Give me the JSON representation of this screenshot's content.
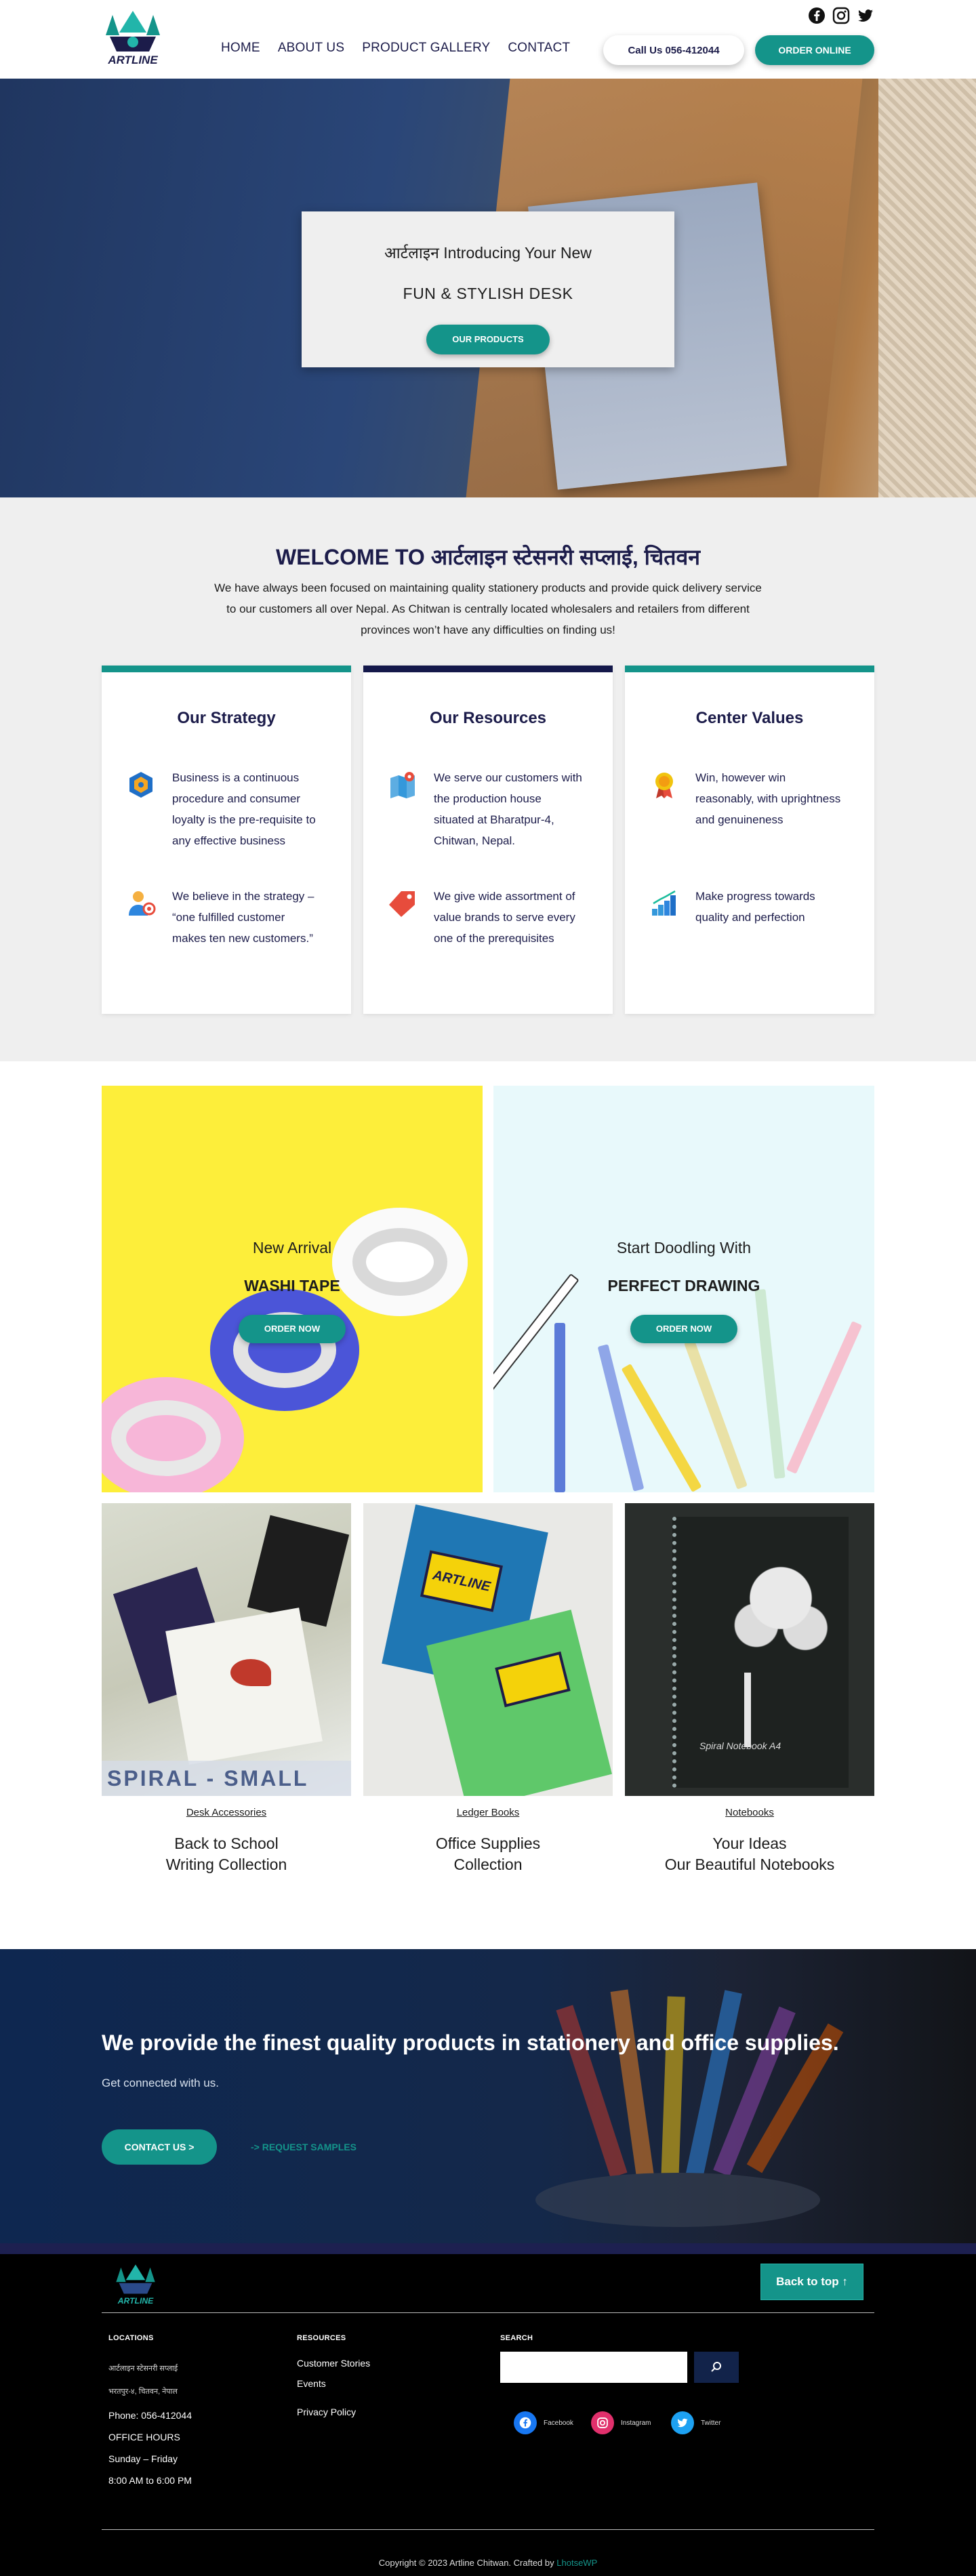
{
  "brand": {
    "logo_text": "ARTLINE",
    "logo_colors": {
      "teal": "#14948a",
      "navy": "#1c1c4a"
    }
  },
  "header": {
    "nav": [
      "HOME",
      "ABOUT US",
      "PRODUCT GALLERY",
      "CONTACT"
    ],
    "call_label": "Call Us 056-412044",
    "order_label": "ORDER ONLINE",
    "social_icons": [
      "facebook-icon",
      "instagram-icon",
      "twitter-icon"
    ]
  },
  "hero": {
    "line1": "आर्टलाइन Introducing Your New",
    "line2": "FUN & STYLISH DESK",
    "button": "OUR PRODUCTS"
  },
  "welcome": {
    "title": "WELCOME TO आर्टलाइन स्टेसनरी सप्लाई, चितवन",
    "text": "We have always been focused on maintaining quality stationery products and provide quick delivery service to our customers all over Nepal. As Chitwan is centrally located wholesalers and retailers from different provinces won’t have any difficulties on finding us!",
    "cards": [
      {
        "title": "Our Strategy",
        "bar_color": "#14948a",
        "items": [
          {
            "icon": "strategy-hexagon-icon",
            "text": "Business is a continuous procedure and consumer loyalty is the pre-requisite to any effective business"
          },
          {
            "icon": "person-target-icon",
            "text": "We believe in the strategy – “one fulfilled customer makes ten new customers.”"
          }
        ]
      },
      {
        "title": "Our Resources",
        "bar_color": "#14184a",
        "items": [
          {
            "icon": "map-pin-icon",
            "text": "We serve our customers with the production house situated at Bharatpur-4, Chitwan, Nepal."
          },
          {
            "icon": "price-tag-icon",
            "text": "We give wide assortment of value brands to serve every one of the prerequisites"
          }
        ]
      },
      {
        "title": "Center Values",
        "bar_color": "#14948a",
        "items": [
          {
            "icon": "award-medal-icon",
            "text": "Win, however win reasonably, with uprightness and genuineness"
          },
          {
            "icon": "growth-stairs-icon",
            "text": "Make progress towards quality and perfection"
          }
        ]
      }
    ]
  },
  "promo": {
    "left": {
      "line1": "New Arrival",
      "line2": "WASHI TAPE",
      "button": "ORDER NOW"
    },
    "right": {
      "line1": "Start Doodling With",
      "line2": "PERFECT DRAWING",
      "button": "ORDER NOW"
    },
    "tiles": [
      {
        "link": "Desk Accessories",
        "caption1": "Back to School",
        "caption2": "Writing Collection",
        "overlay": "SPIRAL - SMALL"
      },
      {
        "link": "Ledger Books",
        "caption1": "Office Supplies",
        "caption2": "Collection",
        "overlay": "ARTLINE"
      },
      {
        "link": "Notebooks",
        "caption1": "Your Ideas",
        "caption2": "Our Beautiful Notebooks",
        "overlay": "Spiral Notebook A4"
      }
    ]
  },
  "cta": {
    "title": "We provide the finest quality products in stationery and office supplies.",
    "subtitle": "Get connected with us.",
    "button": "CONTACT US >",
    "link": "-> REQUEST SAMPLES"
  },
  "footer": {
    "back_to_top": "Back to top ↑",
    "locations": {
      "heading": "LOCATIONS",
      "line1": "आर्टलाइन स्टेसनरी सप्लाई",
      "line2": "भरतपुर-४, चितवन, नेपाल",
      "phone": "Phone: 056-412044",
      "hours_label": "OFFICE HOURS",
      "days": "Sunday – Friday",
      "time": "8:00 AM to 6:00 PM"
    },
    "resources": {
      "heading": "RESOURCES",
      "items": [
        "Customer Stories",
        "Events",
        "Privacy Policy"
      ]
    },
    "search": {
      "heading": "SEARCH",
      "placeholder": ""
    },
    "social": [
      {
        "label": "Facebook",
        "icon": "facebook-icon",
        "color": "#1877f2"
      },
      {
        "label": "Instagram",
        "icon": "instagram-icon",
        "color": "#e1306c"
      },
      {
        "label": "Twitter",
        "icon": "twitter-icon",
        "color": "#1da1f2"
      }
    ],
    "copyright": "Copyright © 2023 Artline Chitwan. Crafted by",
    "crafted_by": "LhotseWP"
  }
}
